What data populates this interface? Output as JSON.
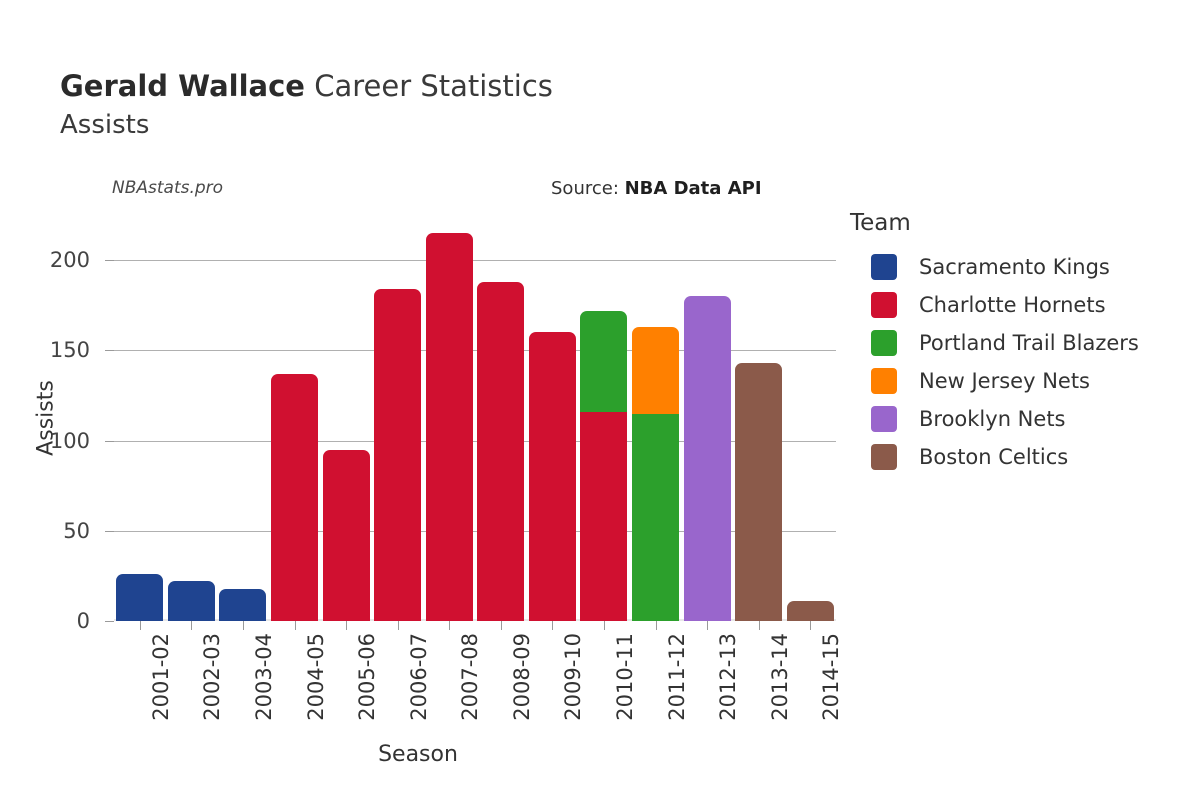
{
  "header": {
    "player": "Gerald Wallace",
    "suffix": " Career Statistics",
    "subtitle": "Assists"
  },
  "annotations": {
    "watermark": "NBAstats.pro",
    "source_label": "Source: ",
    "source_value": "NBA Data API"
  },
  "legend": {
    "title": "Team"
  },
  "axis": {
    "x_title": "Season",
    "y_title": "Assists"
  },
  "chart_data": {
    "type": "bar",
    "stacked": true,
    "title": "Gerald Wallace Career Statistics — Assists",
    "xlabel": "Season",
    "ylabel": "Assists",
    "ylim": [
      0,
      215
    ],
    "yticks": [
      0,
      50,
      100,
      150,
      200
    ],
    "ytick_labels": [
      "0",
      "50",
      "100",
      "150",
      "200"
    ],
    "grid": "horizontal",
    "legend_position": "right",
    "legend_title": "Team",
    "categories": [
      "2001-02",
      "2002-03",
      "2003-04",
      "2004-05",
      "2005-06",
      "2006-07",
      "2007-08",
      "2008-09",
      "2009-10",
      "2010-11",
      "2011-12",
      "2012-13",
      "2013-14",
      "2014-15"
    ],
    "series": [
      {
        "name": "Sacramento Kings",
        "color": "#1f4490",
        "values": [
          26,
          22,
          18,
          0,
          0,
          0,
          0,
          0,
          0,
          0,
          0,
          0,
          0,
          0
        ]
      },
      {
        "name": "Charlotte Hornets",
        "color": "#d01030",
        "values": [
          0,
          0,
          0,
          137,
          95,
          184,
          215,
          188,
          160,
          116,
          0,
          0,
          0,
          0
        ]
      },
      {
        "name": "Portland Trail Blazers",
        "color": "#2ca02c",
        "values": [
          0,
          0,
          0,
          0,
          0,
          0,
          0,
          0,
          0,
          56,
          115,
          0,
          0,
          0
        ]
      },
      {
        "name": "New Jersey Nets",
        "color": "#ff8000",
        "values": [
          0,
          0,
          0,
          0,
          0,
          0,
          0,
          0,
          0,
          0,
          48,
          0,
          0,
          0
        ]
      },
      {
        "name": "Brooklyn Nets",
        "color": "#9966cc",
        "values": [
          0,
          0,
          0,
          0,
          0,
          0,
          0,
          0,
          0,
          0,
          0,
          180,
          0,
          0
        ]
      },
      {
        "name": "Boston Celtics",
        "color": "#8b5a4a",
        "values": [
          0,
          0,
          0,
          0,
          0,
          0,
          0,
          0,
          0,
          0,
          0,
          0,
          143,
          11
        ]
      }
    ],
    "totals": [
      26,
      22,
      18,
      137,
      95,
      184,
      215,
      188,
      160,
      172,
      163,
      180,
      143,
      11
    ]
  }
}
